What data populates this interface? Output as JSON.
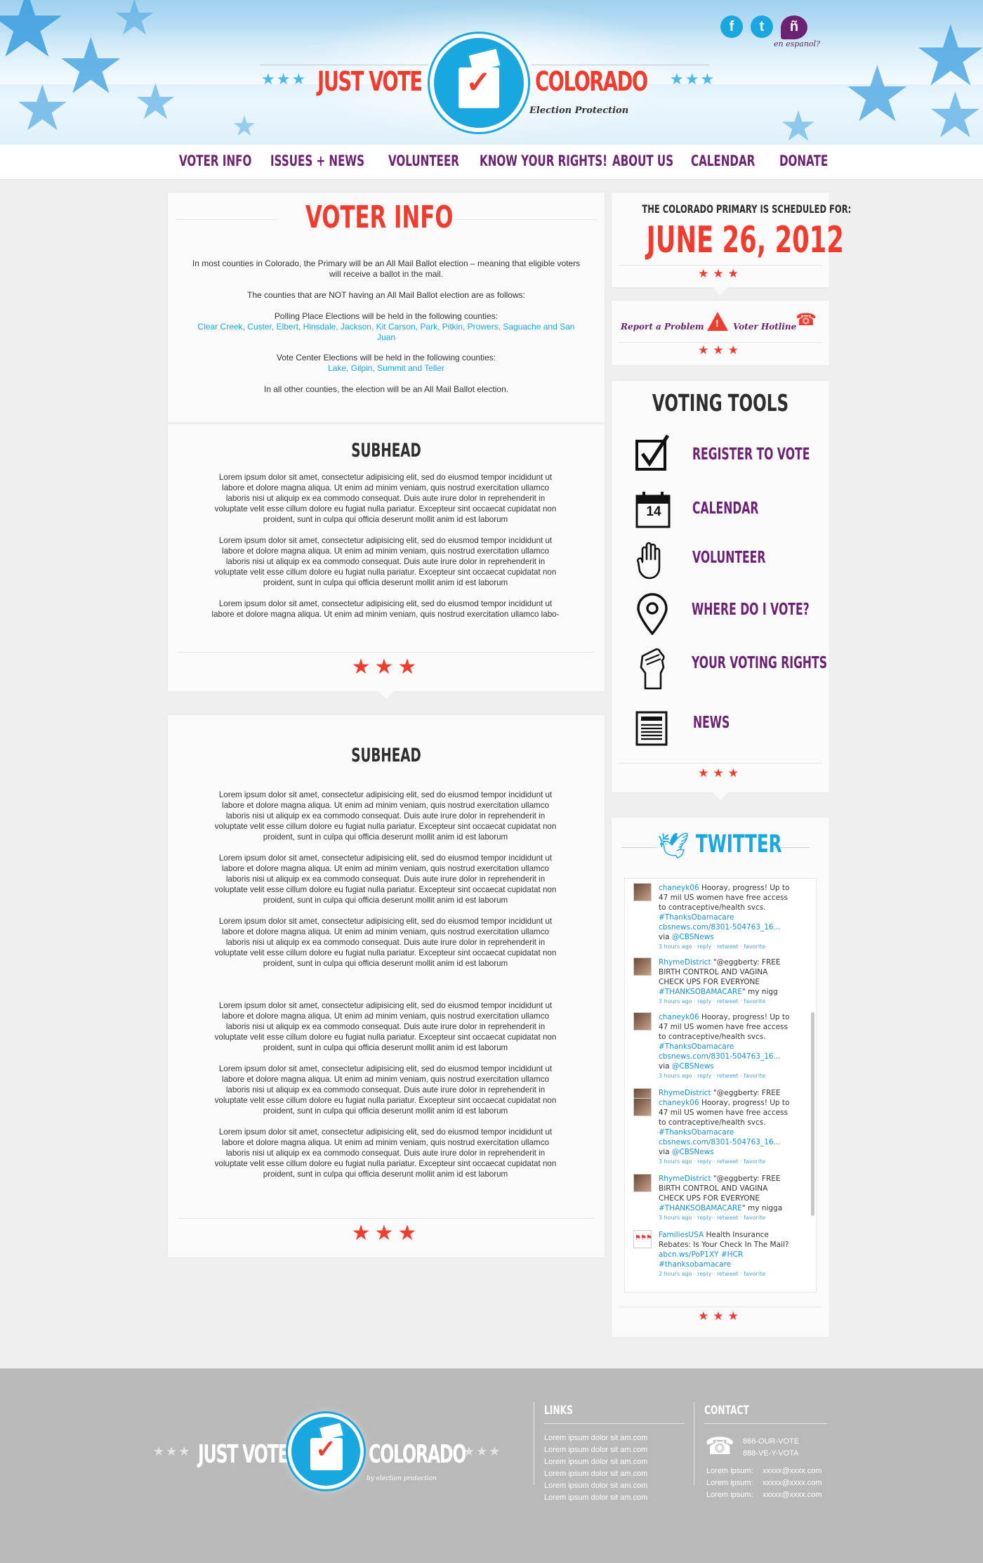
{
  "header": {
    "logo_left": "JUST VOTE",
    "logo_right": "COLORADO",
    "logo_tagline": "Election Protection",
    "espanol_label": "en espanol?",
    "social": {
      "facebook": "f",
      "twitter": "t",
      "espanol": "ñ"
    }
  },
  "nav": {
    "items": [
      "VOTER INFO",
      "ISSUES + NEWS",
      "VOLUNTEER",
      "KNOW YOUR RIGHTS!",
      "ABOUT US",
      "CALENDAR",
      "DONATE"
    ]
  },
  "voter_info": {
    "title": "VOTER INFO",
    "p1": "In most counties in Colorado, the Primary will be an All Mail Ballot election – meaning that eligible voters will receive a ballot in the mail.",
    "p2": "The counties that are NOT having an All Mail Ballot election are as follows:",
    "p3_label": "Polling Place Elections will be held in the following counties:",
    "p3_counties": "Clear Creek, Custer, Elbert, Hinsdale, Jackson, Kit Carson, Park, Pitkin, Prowers, Saguache and San Juan",
    "p4_label": "Vote Center Elections will be held in the following counties:",
    "p4_counties": "Lake, Gilpin, Summit and Teller",
    "p5": "In all other counties, the election will be an All Mail Ballot election."
  },
  "article1": {
    "subhead": "SUBHEAD",
    "paragraphs": [
      "Lorem ipsum dolor sit amet, consectetur adipisicing elit, sed do eiusmod tempor incididunt ut labore et dolore magna aliqua. Ut enim ad minim veniam, quis nostrud exercitation ullamco laboris nisi ut aliquip ex ea commodo consequat. Duis aute irure dolor in reprehenderit in voluptate velit esse cillum dolore eu fugiat nulla pariatur. Excepteur sint occaecat cupidatat non proident, sunt in culpa qui officia deserunt mollit anim id est laborum",
      "Lorem ipsum dolor sit amet, consectetur adipisicing elit, sed do eiusmod tempor incididunt ut labore et dolore magna aliqua. Ut enim ad minim veniam, quis nostrud exercitation ullamco laboris nisi ut aliquip ex ea commodo consequat. Duis aute irure dolor in reprehenderit in voluptate velit esse cillum dolore eu fugiat nulla pariatur. Excepteur sint occaecat cupidatat non proident, sunt in culpa qui officia deserunt mollit anim id est laborum",
      "Lorem ipsum dolor sit amet, consectetur adipisicing elit, sed do eiusmod tempor incididunt ut labore et dolore magna aliqua. Ut enim ad minim veniam, quis nostrud exercitation ullamco labo-"
    ],
    "stars": "★★★"
  },
  "article2": {
    "subhead": "SUBHEAD",
    "paragraphs": [
      "Lorem ipsum dolor sit amet, consectetur adipisicing elit, sed do eiusmod tempor incididunt ut labore et dolore magna aliqua. Ut enim ad minim veniam, quis nostrud exercitation ullamco laboris nisi ut aliquip ex ea commodo consequat. Duis aute irure dolor in reprehenderit in voluptate velit esse cillum dolore eu fugiat nulla pariatur. Excepteur sint occaecat cupidatat non proident, sunt in culpa qui officia deserunt mollit anim id est laborum",
      "Lorem ipsum dolor sit amet, consectetur adipisicing elit, sed do eiusmod tempor incididunt ut labore et dolore magna aliqua. Ut enim ad minim veniam, quis nostrud exercitation ullamco laboris nisi ut aliquip ex ea commodo consequat. Duis aute irure dolor in reprehenderit in voluptate velit esse cillum dolore eu fugiat nulla pariatur. Excepteur sint occaecat cupidatat non proident, sunt in culpa qui officia deserunt mollit anim id est laborum",
      "Lorem ipsum dolor sit amet, consectetur adipisicing elit, sed do eiusmod tempor incididunt ut labore et dolore magna aliqua. Ut enim ad minim veniam, quis nostrud exercitation ullamco laboris nisi ut aliquip ex ea commodo consequat. Duis aute irure dolor in reprehenderit in voluptate velit esse cillum dolore eu fugiat nulla pariatur. Excepteur sint occaecat cupidatat non proident, sunt in culpa qui officia deserunt mollit anim id est laborum",
      "Lorem ipsum dolor sit amet, consectetur adipisicing elit, sed do eiusmod tempor incididunt ut labore et dolore magna aliqua. Ut enim ad minim veniam, quis nostrud exercitation ullamco laboris nisi ut aliquip ex ea commodo consequat. Duis aute irure dolor in reprehenderit in voluptate velit esse cillum dolore eu fugiat nulla pariatur. Excepteur sint occaecat cupidatat non proident, sunt in culpa qui officia deserunt mollit anim id est laborum",
      "Lorem ipsum dolor sit amet, consectetur adipisicing elit, sed do eiusmod tempor incididunt ut labore et dolore magna aliqua. Ut enim ad minim veniam, quis nostrud exercitation ullamco laboris nisi ut aliquip ex ea commodo consequat. Duis aute irure dolor in reprehenderit in voluptate velit esse cillum dolore eu fugiat nulla pariatur. Excepteur sint occaecat cupidatat non proident, sunt in culpa qui officia deserunt mollit anim id est laborum",
      "Lorem ipsum dolor sit amet, consectetur adipisicing elit, sed do eiusmod tempor incididunt ut labore et dolore magna aliqua. Ut enim ad minim veniam, quis nostrud exercitation ullamco laboris nisi ut aliquip ex ea commodo consequat. Duis aute irure dolor in reprehenderit in voluptate velit esse cillum dolore eu fugiat nulla pariatur. Excepteur sint occaecat cupidatat non proident, sunt in culpa qui officia deserunt mollit anim id est laborum"
    ],
    "stars": "★★★"
  },
  "primary": {
    "label": "THE COLORADO PRIMARY IS SCHEDULED FOR:",
    "date": "JUNE 26, 2012",
    "stars": "★★★"
  },
  "alerts": {
    "report_label": "Report a Problem",
    "hotline_label": "Voter Hotline",
    "stars": "★★★"
  },
  "tools": {
    "title": "VOTING TOOLS",
    "items": [
      {
        "label": "REGISTER TO VOTE",
        "icon": "checkbox-icon"
      },
      {
        "label": "CALENDAR",
        "icon": "calendar-icon",
        "day": "14"
      },
      {
        "label": "VOLUNTEER",
        "icon": "hand-icon"
      },
      {
        "label": "WHERE DO I VOTE?",
        "icon": "map-pin-icon"
      },
      {
        "label": "YOUR VOTING RIGHTS",
        "icon": "fist-icon"
      },
      {
        "label": "NEWS",
        "icon": "newspaper-icon"
      }
    ],
    "stars": "★★★"
  },
  "twitter": {
    "title": "TWITTER",
    "stars": "★★★",
    "tweets": [
      {
        "user": "chaneyk06",
        "text": " Hooray, progress! Up to 47 mil US women have free access to contraceptive/health svcs. ",
        "hashtag": "#ThanksObamacare",
        "link": "cbsnews.com/8301-504763_16...",
        "via": " via ",
        "via_user": "@CBSNews",
        "meta": "3 hours ago · reply · retweet · favorite"
      },
      {
        "user": "RhymeDistrict",
        "text": " \"@eggberty: FREE BIRTH CONTROL AND VAGINA CHECK UPS FOR EVERYONE ",
        "hashtag": "#THANKSOBAMACARE",
        "link": "",
        "via": "\" my nigg",
        "via_user": "",
        "meta": "3 hours ago · reply · retweet · favorite"
      },
      {
        "user": "chaneyk06",
        "text": " Hooray, progress! Up to 47 mil US women have free access to contraceptive/health svcs. ",
        "hashtag": "#ThanksObamacare",
        "link": "cbsnews.com/8301-504763_16...",
        "via": " via ",
        "via_user": "@CBSNews",
        "meta": "3 hours ago · reply · retweet · favorite"
      },
      {
        "user": "RhymeDistrict",
        "text": " \"@eggberty: FREE BIRTH CONTROL AND VAGINA",
        "hashtag": "",
        "link": "",
        "via": "",
        "via_user": "",
        "meta": ""
      },
      {
        "user": "chaneyk06",
        "text": " Hooray, progress! Up to 47 mil US women have free access to contraceptive/health svcs. ",
        "hashtag": "#ThanksObamacare",
        "link": "cbsnews.com/8301-504763_16...",
        "via": " via ",
        "via_user": "@CBSNews",
        "meta": "3 hours ago · reply · retweet · favorite"
      },
      {
        "user": "RhymeDistrict",
        "text": " \"@eggberty: FREE BIRTH CONTROL AND VAGINA CHECK UPS FOR EVERYONE ",
        "hashtag": "#THANKSOBAMACARE",
        "link": "",
        "via": "\" my nigga",
        "via_user": "",
        "meta": "3 hours ago · reply · retweet · favorite"
      },
      {
        "user": "FamiliesUSA",
        "text": " Health Insurance Rebates: Is Your Check In The Mail? ",
        "hashtag": "#thanksobamacare",
        "link": "abcn.ws/PoP1XY",
        "via": " ",
        "via_user": "#HCR",
        "meta": "2 hours ago · reply · retweet · favorite"
      }
    ]
  },
  "footer": {
    "logo_left": "JUST VOTE",
    "logo_right": "COLORADO",
    "logo_tagline": "by election protection",
    "links_title": "LINKS",
    "links": [
      "Lorem ipsum dolor sit am.com",
      "Lorem ipsum dolor sit am.com",
      "Lorem ipsum dolor sit am.com",
      "Lorem ipsum dolor sit am.com",
      "Lorem ipsum dolor sit am.com",
      "Lorem ipsum dolor sit am.com"
    ],
    "contact_title": "CONTACT",
    "phone1": "866-OUR-VOTE",
    "phone2": "888-VE-Y-VOTA",
    "contacts": [
      {
        "label": "Lorem ipsum:",
        "value": "xxxxx@xxxx.com"
      },
      {
        "label": "Lorem ipsum:",
        "value": "xxxxx@xxxx.com"
      },
      {
        "label": "Lorem ipsum:",
        "value": "xxxxx@xxxx.com"
      }
    ]
  },
  "colors": {
    "accent_red": "#f03c2e",
    "accent_blue": "#1aa7e0",
    "nav_purple": "#6b2371",
    "footer_gray": "#b9b9b9"
  }
}
